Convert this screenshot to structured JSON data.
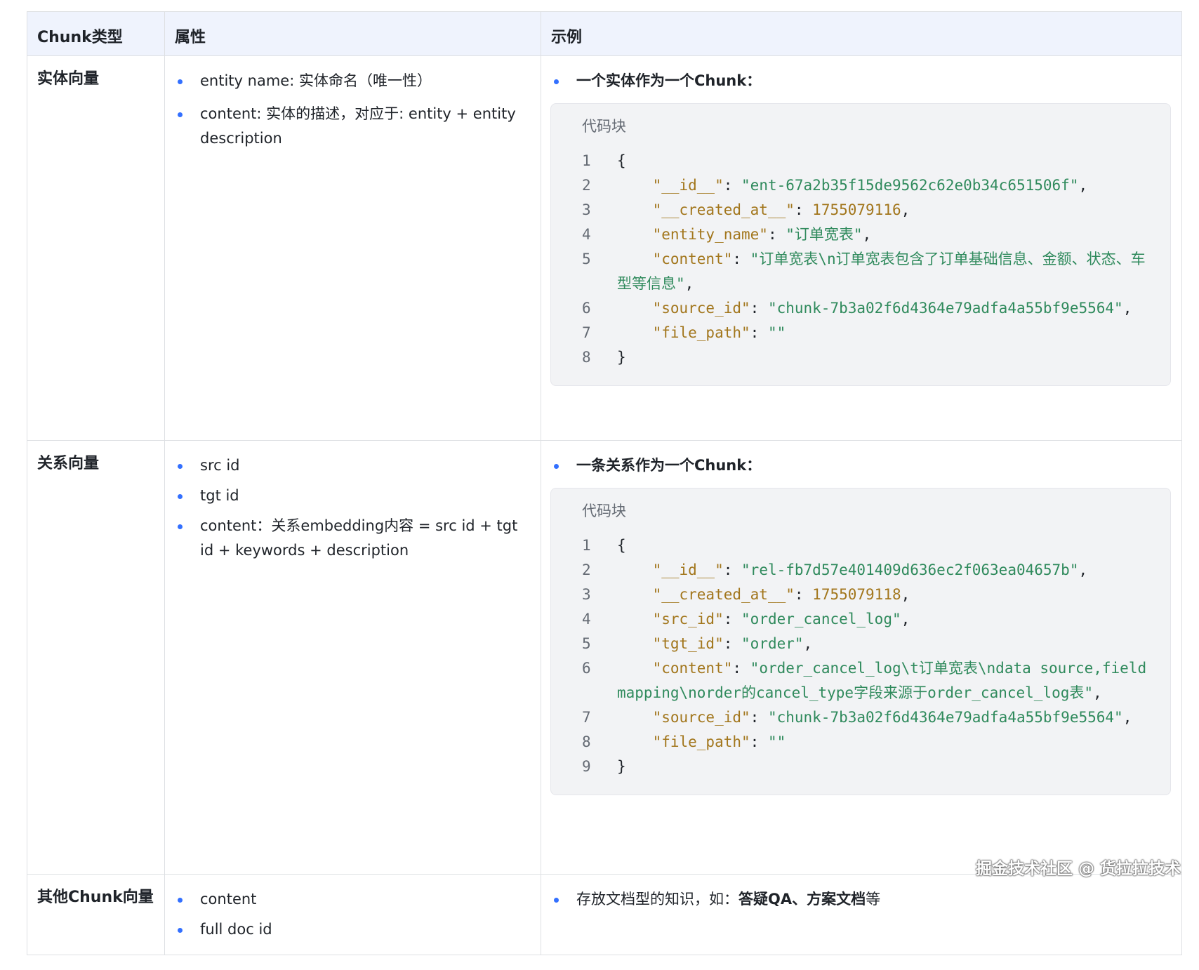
{
  "header": {
    "col1": "Chunk类型",
    "col2": "属性",
    "col3": "示例"
  },
  "rows": [
    {
      "type": "实体向量",
      "attributes": [
        "entity name: 实体命名（唯一性）",
        "content: 实体的描述，对应于: entity + entity description"
      ],
      "example_head": "一个实体作为一个Chunk：",
      "code_caption": "代码块",
      "code_lines": [
        {
          "ln": "1",
          "text": "{"
        },
        {
          "ln": "2",
          "key": "\"__id__\"",
          "sep": ": ",
          "val": "\"ent-67a2b35f15de9562c62e0b34c651506f\"",
          "end": ","
        },
        {
          "ln": "3",
          "key": "\"__created_at__\"",
          "sep": ": ",
          "num": "1755079116",
          "end": ","
        },
        {
          "ln": "4",
          "key": "\"entity_name\"",
          "sep": ": ",
          "val": "\"订单宽表\"",
          "end": ","
        },
        {
          "ln": "5",
          "key": "\"content\"",
          "sep": ": ",
          "val": "\"订单宽表\\n订单宽表包含了订单基础信息、金额、状态、车型等信息\"",
          "end": ","
        },
        {
          "ln": "6",
          "key": "\"source_id\"",
          "sep": ": ",
          "val": "\"chunk-7b3a02f6d4364e79adfa4a55bf9e5564\"",
          "end": ","
        },
        {
          "ln": "7",
          "key": "\"file_path\"",
          "sep": ": ",
          "val": "\"\"",
          "end": ""
        },
        {
          "ln": "8",
          "text": "}"
        }
      ]
    },
    {
      "type": "关系向量",
      "attributes": [
        "src id",
        "tgt id",
        "content：关系embedding内容 = src id + tgt id + keywords + description"
      ],
      "example_head": "一条关系作为一个Chunk：",
      "code_caption": "代码块",
      "code_lines": [
        {
          "ln": "1",
          "text": "{"
        },
        {
          "ln": "2",
          "key": "\"__id__\"",
          "sep": ": ",
          "val": "\"rel-fb7d57e401409d636ec2f063ea04657b\"",
          "end": ","
        },
        {
          "ln": "3",
          "key": "\"__created_at__\"",
          "sep": ": ",
          "num": "1755079118",
          "end": ","
        },
        {
          "ln": "4",
          "key": "\"src_id\"",
          "sep": ": ",
          "val": "\"order_cancel_log\"",
          "end": ","
        },
        {
          "ln": "5",
          "key": "\"tgt_id\"",
          "sep": ": ",
          "val": "\"order\"",
          "end": ","
        },
        {
          "ln": "6",
          "key": "\"content\"",
          "sep": ": ",
          "val": "\"order_cancel_log\\t订单宽表\\ndata source,field mapping\\norder的cancel_type字段来源于order_cancel_log表\"",
          "end": ","
        },
        {
          "ln": "7",
          "key": "\"source_id\"",
          "sep": ": ",
          "val": "\"chunk-7b3a02f6d4364e79adfa4a55bf9e5564\"",
          "end": ","
        },
        {
          "ln": "8",
          "key": "\"file_path\"",
          "sep": ": ",
          "val": "\"\"",
          "end": ""
        },
        {
          "ln": "9",
          "text": "}"
        }
      ]
    },
    {
      "type": "其他Chunk向量",
      "attributes": [
        "content",
        "full doc id"
      ],
      "example_plain": "存放文档型的知识，如：",
      "example_bold": "答疑QA、方案文档",
      "example_tail": "等"
    }
  ],
  "footer_watermark": "掘金技术社区 @ 货拉拉技术"
}
